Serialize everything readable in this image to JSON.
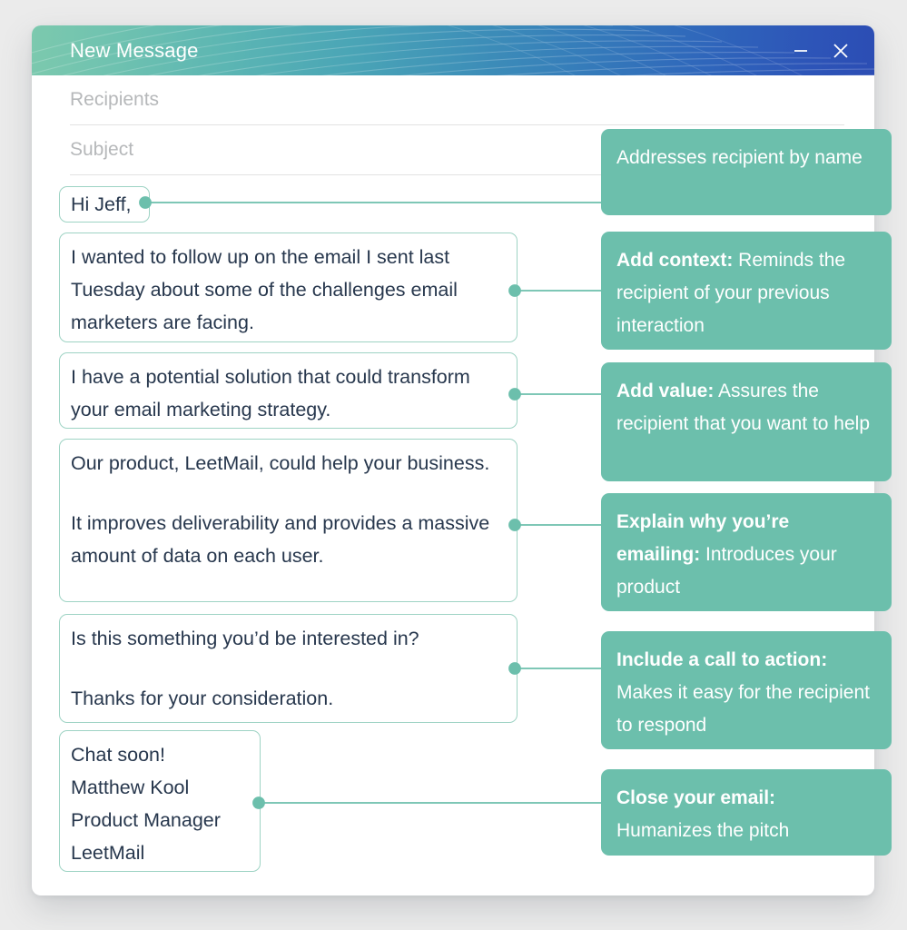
{
  "window": {
    "title": "New Message",
    "minimize_label": "–",
    "close_label": "✕"
  },
  "fields": {
    "recipients_placeholder": "Recipients",
    "recipients_value": "",
    "subject_placeholder": "Subject",
    "subject_value": ""
  },
  "colors": {
    "callout_bg": "#6cbfac",
    "box_border": "#9ed3c4",
    "body_text": "#27374d",
    "placeholder": "#b6b8ba",
    "page_bg": "#ebebeb",
    "header_gradient_start": "#7cc9ae",
    "header_gradient_end": "#2c4db4"
  },
  "email_blocks": [
    {
      "id": "greeting",
      "lines": [
        "Hi Jeff,"
      ]
    },
    {
      "id": "context",
      "lines": [
        "I wanted to follow up on the email I sent last Tuesday about some of the challenges email marketers are facing."
      ]
    },
    {
      "id": "value",
      "lines": [
        "I have a potential solution that could transform  your email marketing strategy."
      ]
    },
    {
      "id": "product",
      "lines": [
        "Our product, LeetMail, could help your business.",
        "It improves deliverability and provides a massive amount of data on each user."
      ]
    },
    {
      "id": "cta",
      "lines": [
        "Is this something you’d be interested in?",
        "Thanks for your consideration."
      ]
    },
    {
      "id": "signature",
      "lines": [
        "Chat soon!",
        "Matthew Kool",
        "Product Manager",
        "LeetMail"
      ]
    }
  ],
  "callouts": [
    {
      "id": "addresses-by-name",
      "bold": "",
      "text": "Addresses recipient by name"
    },
    {
      "id": "add-context",
      "bold": "Add context:",
      "text": "Reminds the recipient of your previous interaction"
    },
    {
      "id": "add-value",
      "bold": "Add value:",
      "text": "Assures the recipient that you want to help"
    },
    {
      "id": "explain-why",
      "bold": "Explain why you’re emailing:",
      "text": "Introduces your product"
    },
    {
      "id": "call-to-action",
      "bold": "Include a call to action:",
      "text": "Makes it easy for the recipient to respond"
    },
    {
      "id": "close-email",
      "bold": "Close your email:",
      "text": "Humanizes the pitch"
    }
  ]
}
